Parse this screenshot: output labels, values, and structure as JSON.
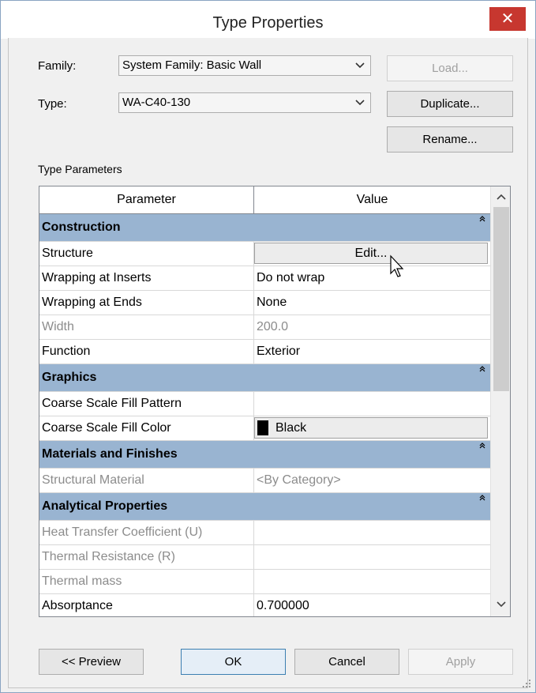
{
  "window": {
    "title": "Type Properties",
    "close_symbol": "✕"
  },
  "family": {
    "label": "Family:",
    "value": "System Family: Basic Wall"
  },
  "type": {
    "label": "Type:",
    "value": "WA-C40-130"
  },
  "buttons": {
    "load": "Load...",
    "duplicate": "Duplicate...",
    "rename": "Rename...",
    "preview": "<< Preview",
    "ok": "OK",
    "cancel": "Cancel",
    "apply": "Apply"
  },
  "type_parameters_label": "Type Parameters",
  "grid": {
    "col_parameter": "Parameter",
    "col_value": "Value",
    "groups": [
      {
        "name": "Construction",
        "rows": [
          {
            "param": "Structure",
            "value": "Edit...",
            "kind": "button",
            "enabled": true
          },
          {
            "param": "Wrapping at Inserts",
            "value": "Do not wrap",
            "enabled": true
          },
          {
            "param": "Wrapping at Ends",
            "value": "None",
            "enabled": true
          },
          {
            "param": "Width",
            "value": "200.0",
            "enabled": false
          },
          {
            "param": "Function",
            "value": "Exterior",
            "enabled": true
          }
        ]
      },
      {
        "name": "Graphics",
        "rows": [
          {
            "param": "Coarse Scale Fill Pattern",
            "value": "",
            "enabled": true
          },
          {
            "param": "Coarse Scale Fill Color",
            "value": "Black",
            "kind": "color",
            "swatch": "#000000",
            "enabled": true
          }
        ]
      },
      {
        "name": "Materials and Finishes",
        "rows": [
          {
            "param": "Structural Material",
            "value": "<By Category>",
            "enabled": false
          }
        ]
      },
      {
        "name": "Analytical Properties",
        "rows": [
          {
            "param": "Heat Transfer Coefficient (U)",
            "value": "",
            "enabled": false
          },
          {
            "param": "Thermal Resistance (R)",
            "value": "",
            "enabled": false
          },
          {
            "param": "Thermal mass",
            "value": "",
            "enabled": false
          },
          {
            "param": "Absorptance",
            "value": "0.700000",
            "enabled": true
          }
        ]
      }
    ]
  },
  "colors": {
    "group_header": "#99b4d1",
    "close_button": "#c7372f"
  },
  "icons": {
    "collapse": "collapse-icon",
    "dropdown": "chevron-down-icon"
  }
}
